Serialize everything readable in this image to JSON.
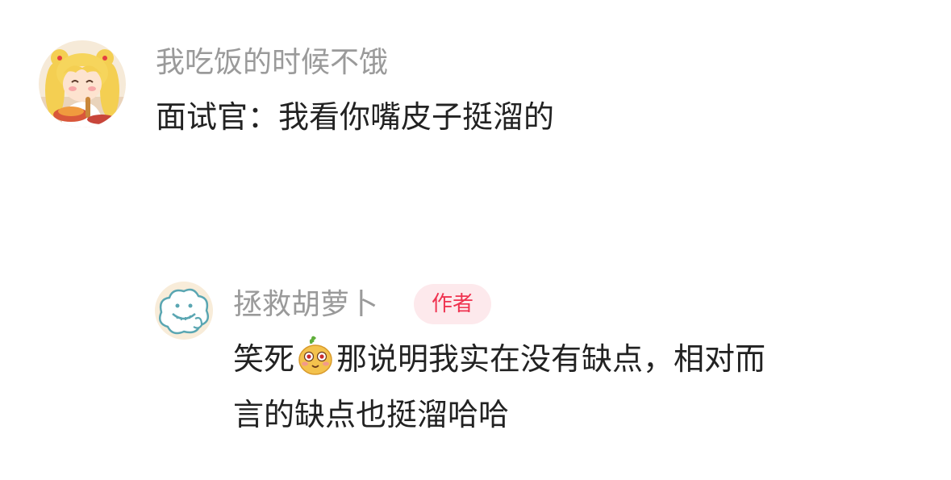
{
  "comment": {
    "username": "我吃饭的时候不饿",
    "text": "面试官：我看你嘴皮子挺溜的",
    "avatar_icon": "sailor-moon-eating-avatar"
  },
  "reply": {
    "username": "拯救胡萝卜",
    "author_badge": "作者",
    "text_before_emoji": "笑死",
    "emoji_icon": "cute-potato-emoji-icon",
    "text_after_emoji": "那说明我实在没有缺点，相对而",
    "text_line2": "言的缺点也挺溜哈哈",
    "avatar_icon": "cartoon-cloud-avatar"
  },
  "colors": {
    "username": "#9a9a9a",
    "text": "#222222",
    "badge_bg": "#fde9ec",
    "badge_text": "#ef3350"
  }
}
